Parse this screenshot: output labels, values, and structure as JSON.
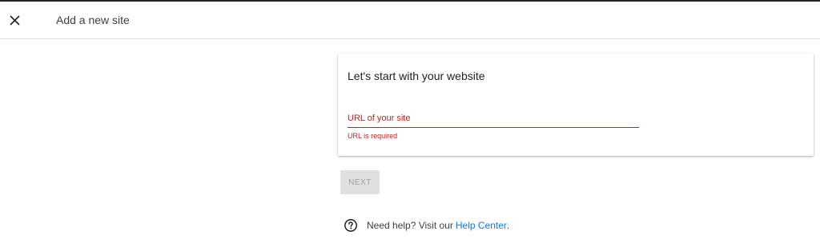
{
  "header": {
    "title": "Add a new site",
    "close_icon": "close-icon"
  },
  "card": {
    "title": "Let's start with your website",
    "url_field": {
      "placeholder": "URL of your site",
      "value": "",
      "error": "URL is required"
    }
  },
  "actions": {
    "next_label": "NEXT"
  },
  "help": {
    "icon": "help-circle-icon",
    "text": "Need help? Visit our",
    "link_label": "Help Center",
    "suffix": "."
  },
  "colors": {
    "error": "#c5221f",
    "link": "#1a73e8",
    "disabled_button_bg": "#e0e0e0",
    "disabled_button_text": "#9e9e9e"
  }
}
